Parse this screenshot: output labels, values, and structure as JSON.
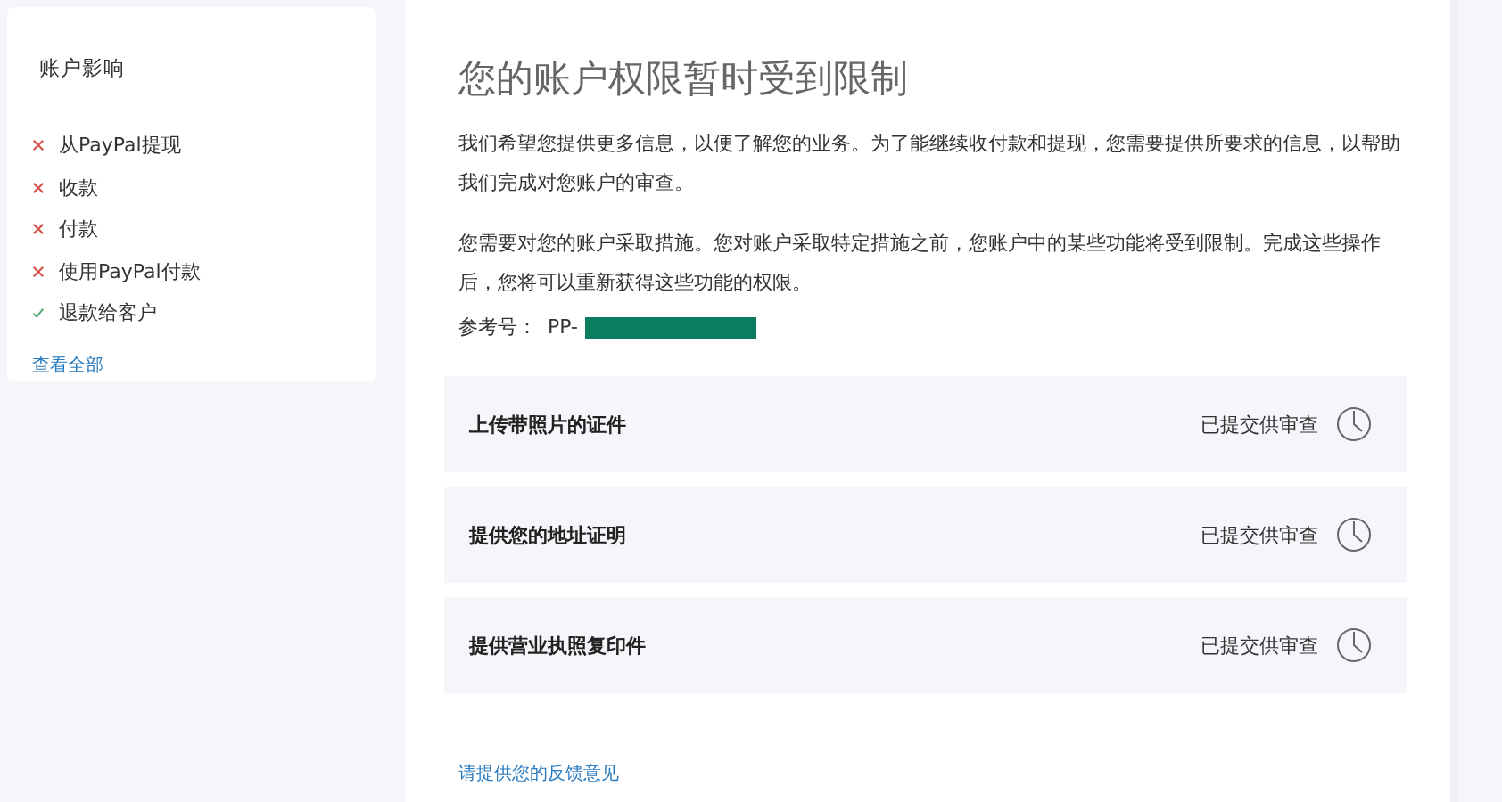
{
  "sidebar": {
    "title": "账户影响",
    "items": [
      {
        "label": "从PayPal提现",
        "allowed": false
      },
      {
        "label": "收款",
        "allowed": false
      },
      {
        "label": "付款",
        "allowed": false
      },
      {
        "label": "使用PayPal付款",
        "allowed": false
      },
      {
        "label": "退款给客户",
        "allowed": true
      }
    ],
    "link": "查看全部"
  },
  "main": {
    "title": "您的账户权限暂时受到限制",
    "paragraphs": [
      "我们希望您提供更多信息，以便了解您的业务。为了能继续收付款和提现，您需要提供所要求的信息，以帮助我们完成对您账户的审查。",
      "您需要对您的账户采取措施。您对账户采取特定措施之前，您账户中的某些功能将受到限制。完成这些操作后，您将可以重新获得这些功能的权限。"
    ],
    "reference": {
      "label": "参考号：",
      "value": "PP-",
      "redacted": true
    },
    "tasks": [
      {
        "label": "上传带照片的证件",
        "status": "已提交供审查"
      },
      {
        "label": "提供您的地址证明",
        "status": "已提交供审查"
      },
      {
        "label": "提供营业执照复印件",
        "status": "已提交供审查"
      }
    ],
    "feedback_link": "请提供您的反馈意见"
  }
}
